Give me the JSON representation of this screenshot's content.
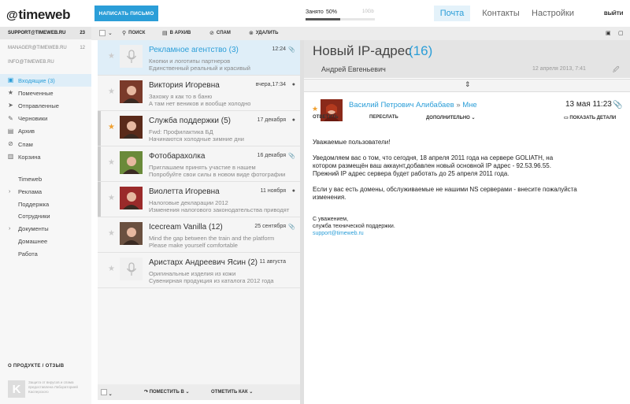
{
  "header": {
    "logo": "timeweb",
    "compose_label": "НАПИСАТЬ ПИСЬМО",
    "quota": {
      "label": "Занято",
      "value": "50%",
      "max": "10Gb",
      "fraction": 0.5
    },
    "tabs": [
      "Почта",
      "Контакты",
      "Настройки"
    ],
    "active_tab": "Почта",
    "logout": "ВЫЙТИ"
  },
  "accounts": [
    {
      "email": "SUPPORT@TIMEWEB.RU",
      "count": "23"
    },
    {
      "email": "MANAGER@TIMEWEB.RU",
      "count": "12"
    },
    {
      "email": "INFO@TIMEWEB.RU",
      "count": ""
    }
  ],
  "folders": [
    {
      "label": "Входящие (3)",
      "icon": "inbox-icon",
      "glyph": "▣"
    },
    {
      "label": "Помеченные",
      "icon": "star-icon",
      "glyph": "★"
    },
    {
      "label": "Отправленные",
      "icon": "send-icon",
      "glyph": "➤"
    },
    {
      "label": "Черновики",
      "icon": "pencil-icon",
      "glyph": "✎"
    },
    {
      "label": "Архив",
      "icon": "archive-icon",
      "glyph": "▤"
    },
    {
      "label": "Спам",
      "icon": "spam-icon",
      "glyph": "⊘"
    },
    {
      "label": "Корзина",
      "icon": "trash-icon",
      "glyph": "▥"
    }
  ],
  "labels": [
    {
      "label": "Timeweb",
      "expandable": false
    },
    {
      "label": "Реклама",
      "expandable": true
    },
    {
      "label": "Поддержка",
      "expandable": false
    },
    {
      "label": "Сотрудники",
      "expandable": false
    },
    {
      "label": "Документы",
      "expandable": true
    },
    {
      "label": "Домашнее",
      "expandable": false
    },
    {
      "label": "Работа",
      "expandable": false
    }
  ],
  "footer": {
    "about": "О ПРОДУКТЕ / ОТЗЫВ",
    "copyright": "Защита от вирусов и спама предоставлена Лабораторией Касперского"
  },
  "toolbar": {
    "search": "ПОИСК",
    "archive": "В АРХИВ",
    "spam": "СПАМ",
    "delete": "УДАЛИТЬ"
  },
  "messages": [
    {
      "from": "Рекламное агентство (3)",
      "date": "12:24",
      "line1": "Кнопки и логотипы партнеров",
      "line2": "Единственный реальный и красивый",
      "starred": false,
      "selected": true,
      "avatar": "placeholder",
      "marker": "📎"
    },
    {
      "from": "Виктория Игоревна",
      "date": "вчера,17:34",
      "line1": "Захожу я как то в баню",
      "line2": "А там нет веников и вообще холодно",
      "starred": false,
      "selected": false,
      "avatar": "photo",
      "marker": "●"
    },
    {
      "from": "Служба поддержки (5)",
      "date": "17 декабря",
      "line1": "Fwd: Профилактика БД",
      "line2": "Начинаются холодные зимние дни",
      "starred": true,
      "selected": false,
      "avatar": "photo",
      "marker": "●"
    },
    {
      "from": "Фотобарахолка",
      "date": "16 декабря",
      "line1": "Приглашаем принять участие в нашем",
      "line2": "Попробуйте свои силы в новом виде фотографии",
      "starred": false,
      "selected": false,
      "avatar": "photo",
      "marker": "📎"
    },
    {
      "from": "Виолетта Игоревна",
      "date": "11 ноября",
      "line1": "Налоговые декларации 2012",
      "line2": "Изменения налогового законодательства приводят",
      "starred": false,
      "selected": false,
      "avatar": "photo",
      "marker": "●"
    },
    {
      "from": "Icecream Vanilla (12)",
      "date": "25 сентября",
      "line1": "Mind the gap between the train and the platform",
      "line2": "Please make yourself comfortable",
      "starred": false,
      "selected": false,
      "avatar": "photo",
      "marker": "📎"
    },
    {
      "from": "Аристарх Андреевич Ясин (2)",
      "date": "11 августа",
      "line1": "Оригинальные изделия из кожи",
      "line2": "Сувенирная продукция из каталога 2012 года",
      "starred": false,
      "selected": false,
      "avatar": "placeholder",
      "marker": ""
    }
  ],
  "list_footer": {
    "move": "ПОМЕСТИТЬ В",
    "mark": "ОТМЕТИТЬ КАК"
  },
  "reading": {
    "subject": "Новый IP-адрес",
    "count": "(16)",
    "thread_from": "Андрей Евгеньевич",
    "thread_date": "12 апреля 2013, 7:41",
    "sender": "Василий Петрович Алибабаев",
    "to": "Мне",
    "date": "13 мая 11:23",
    "actions": {
      "reply": "ОТВЕТИТЬ",
      "forward": "ПЕРЕСЛАТЬ",
      "more": "ДОПОЛНИТЕЛЬНО",
      "details": "ПОКАЗАТЬ ДЕТАЛИ"
    },
    "greeting": "Уважаемые пользователи!",
    "p1a": "Уведомляем вас о том, что сегодня, 18 апреля 2011 года на сервере GOLIATH, на",
    "p1b": "котором размещён ваш аккаунт,добавлен новый основной IP адрес - 92.53.96.55.",
    "p1c": "Прежний IP адрес сервера будет работать до 25 апреля 2011 года.",
    "p2a": "Если у вас есть домены, обслуживаемые не нашими NS серверами - внесите пожалуйста",
    "p2b": "изменения.",
    "sig1": "С уважением,",
    "sig2": "служба технической поддержки.",
    "sig3": "support@timeweb.ru"
  }
}
